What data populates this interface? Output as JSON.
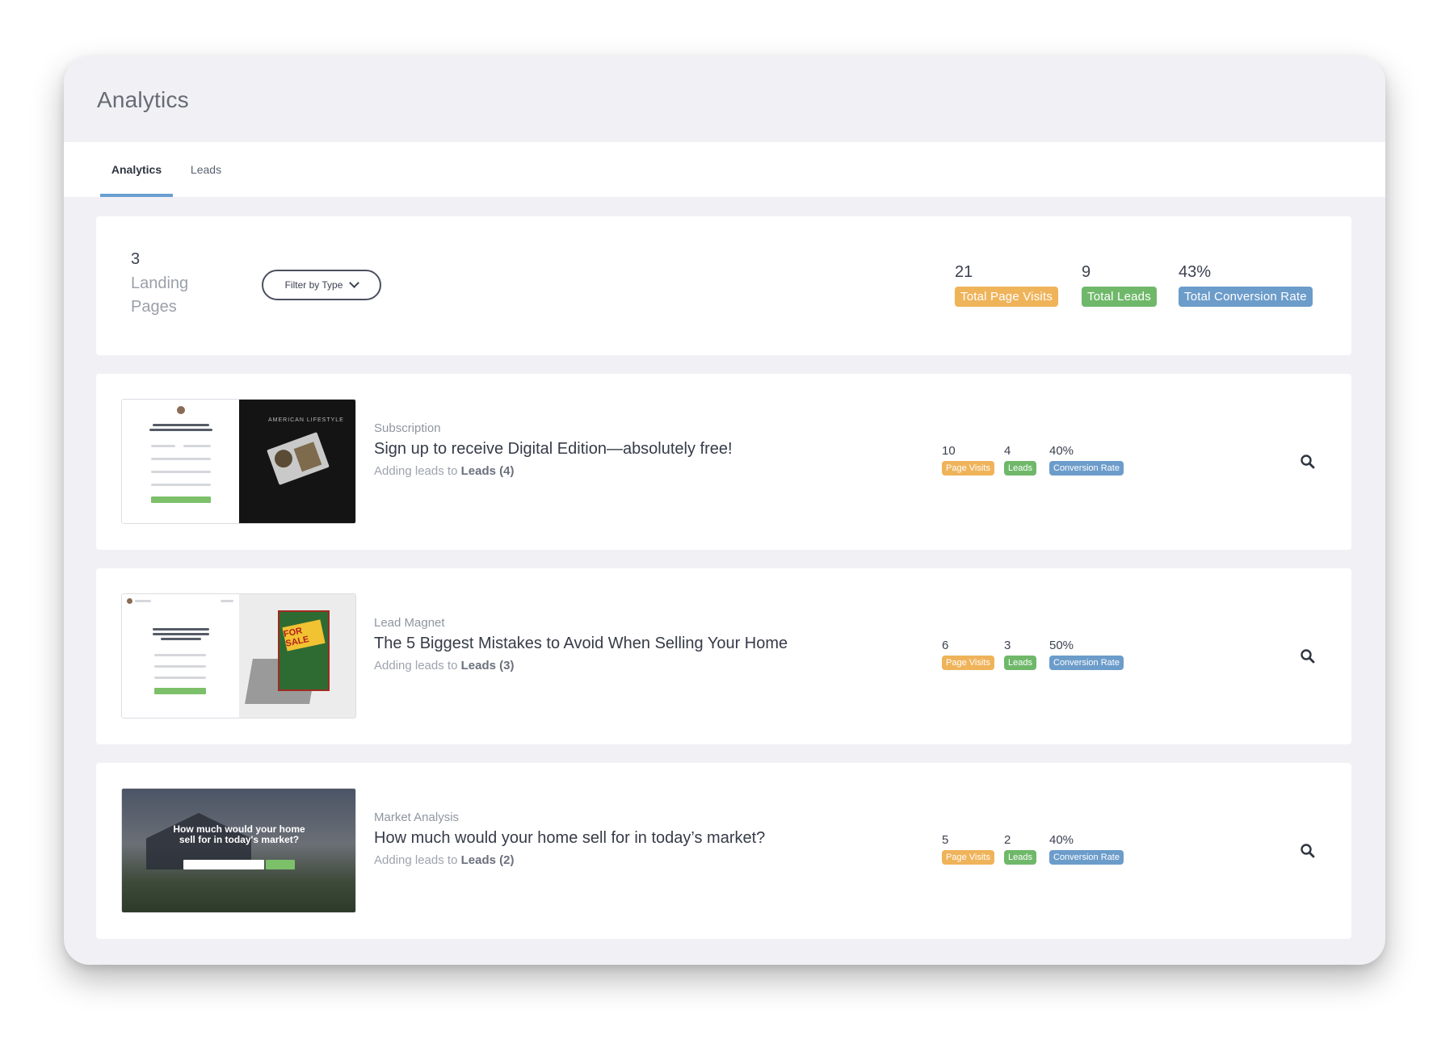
{
  "page": {
    "title": "Analytics"
  },
  "tabs": [
    {
      "label": "Analytics",
      "active": true
    },
    {
      "label": "Leads",
      "active": false
    }
  ],
  "summary": {
    "count": "3",
    "count_label_line1": "Landing",
    "count_label_line2": "Pages",
    "filter_label": "Filter by Type",
    "totals": [
      {
        "value": "21",
        "label": "Total Page Visits",
        "color": "#efb35a"
      },
      {
        "value": "9",
        "label": "Total Leads",
        "color": "#6fb86a"
      },
      {
        "value": "43%",
        "label": "Total Conversion Rate",
        "color": "#6c9cca"
      }
    ]
  },
  "landing_pages": [
    {
      "type": "Subscription",
      "title": "Sign up to receive Digital Edition—absolutely free!",
      "sub_prefix": "Adding leads to",
      "sub_target": "Leads (4)",
      "thumb_text": "AMERICAN LIFESTYLE",
      "stats": [
        {
          "value": "10",
          "label": "Page Visits"
        },
        {
          "value": "4",
          "label": "Leads"
        },
        {
          "value": "40%",
          "label": "Conversion Rate"
        }
      ]
    },
    {
      "type": "Lead Magnet",
      "title": "The 5 Biggest Mistakes to Avoid When Selling Your Home",
      "sub_prefix": "Adding leads to",
      "sub_target": "Leads (3)",
      "thumb_text": "FOR SALE",
      "stats": [
        {
          "value": "6",
          "label": "Page Visits"
        },
        {
          "value": "3",
          "label": "Leads"
        },
        {
          "value": "50%",
          "label": "Conversion Rate"
        }
      ]
    },
    {
      "type": "Market Analysis",
      "title": "How much would your home sell for in today’s market?",
      "sub_prefix": "Adding leads to",
      "sub_target": "Leads (2)",
      "thumb_text": "How much would your home sell for in today's market?",
      "stats": [
        {
          "value": "5",
          "label": "Page Visits"
        },
        {
          "value": "2",
          "label": "Leads"
        },
        {
          "value": "40%",
          "label": "Conversion Rate"
        }
      ]
    }
  ],
  "icons": {
    "row_action": "search-icon",
    "filter_dropdown": "chevron-down-icon"
  }
}
